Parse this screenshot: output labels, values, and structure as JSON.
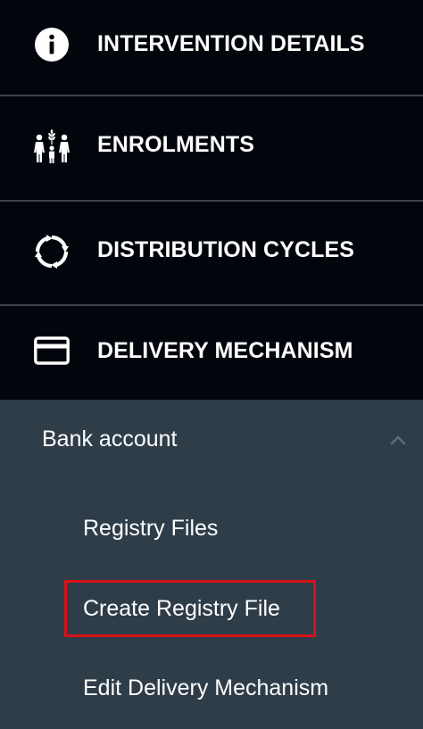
{
  "menu": {
    "items": [
      {
        "label": "INTERVENTION DETAILS",
        "icon": "info-icon"
      },
      {
        "label": "ENROLMENTS",
        "icon": "family-icon"
      },
      {
        "label": "DISTRIBUTION CYCLES",
        "icon": "cycle-arrows-icon"
      },
      {
        "label": "DELIVERY MECHANISM",
        "icon": "credit-card-icon"
      }
    ]
  },
  "submenu": {
    "header": {
      "label": "Bank account",
      "icon": "chevron-up-icon",
      "expanded": true
    },
    "items": [
      {
        "label": "Registry Files"
      },
      {
        "label": "Create Registry File",
        "highlighted": true
      },
      {
        "label": "Edit Delivery Mechanism"
      }
    ]
  },
  "colors": {
    "menu_background": "#02060c",
    "submenu_background": "#2f3d48",
    "divider": "#3a4450",
    "highlight_border": "#d9131a",
    "text": "#ffffff"
  }
}
